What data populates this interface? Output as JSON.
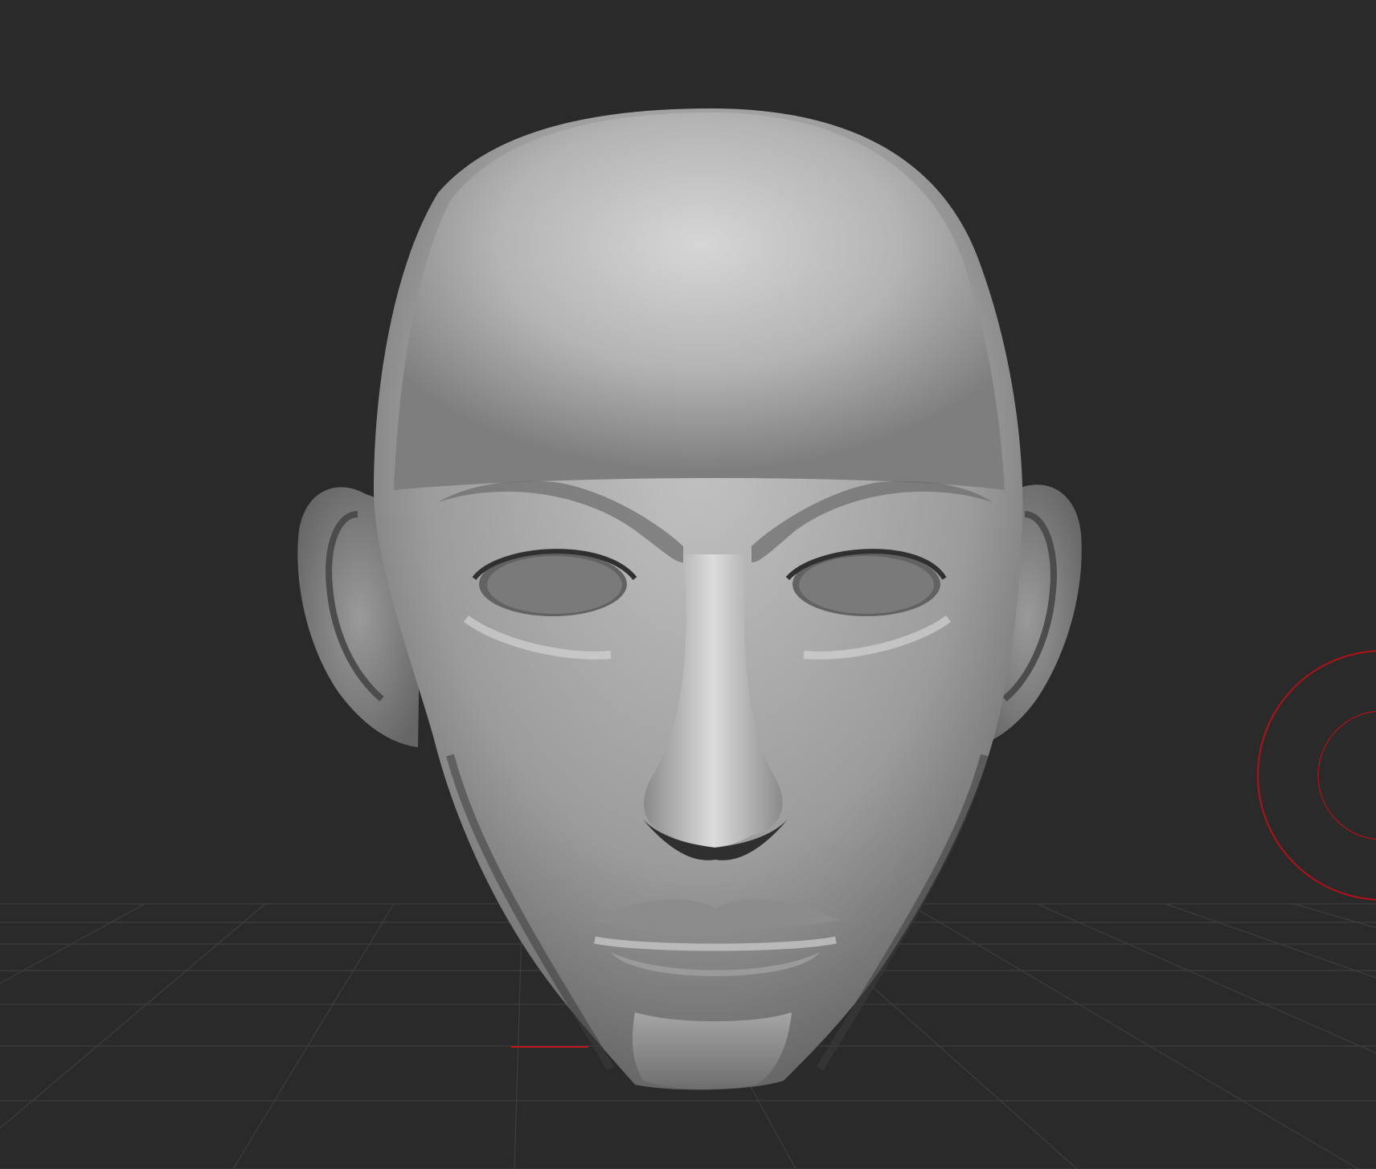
{
  "app": {
    "viewport_kind": "3d-sculpting-canvas"
  },
  "scene": {
    "background_color": "#2a2a2a",
    "grid_color": "#3d3d3d",
    "model": {
      "type": "head-sculpt",
      "material_color": "#a9a9a9"
    },
    "axis_indicator_color": "#c0181c",
    "brush_cursor": {
      "shape": "ring",
      "color": "#b01218"
    }
  }
}
